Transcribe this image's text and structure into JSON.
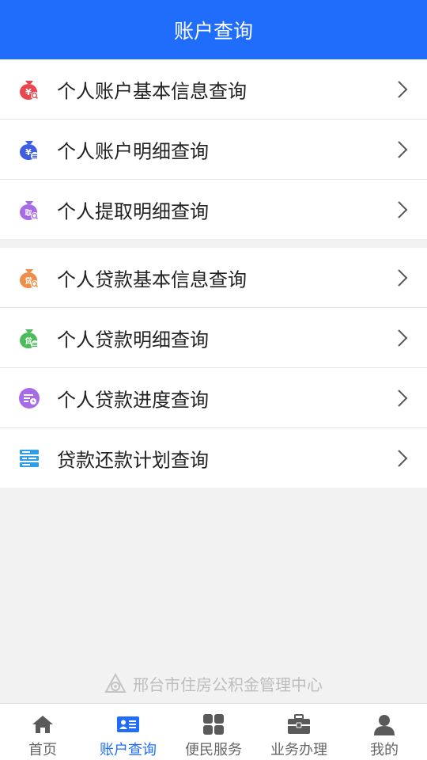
{
  "header": {
    "title": "账户查询"
  },
  "colors": {
    "primary": "#1f6dfa",
    "tab_inactive": "#666666",
    "icon_red": "#e8474e",
    "icon_blue": "#3d5fe0",
    "icon_purple": "#a86be6",
    "icon_orange": "#ee8e4b",
    "icon_green": "#4bbb5b",
    "icon_teal": "#2d9ee8"
  },
  "section1": {
    "items": [
      {
        "label": "个人账户基本信息查询",
        "icon": "money-bag-search-icon"
      },
      {
        "label": "个人账户明细查询",
        "icon": "money-bag-list-icon"
      },
      {
        "label": "个人提取明细查询",
        "icon": "withdraw-bag-search-icon"
      }
    ]
  },
  "section2": {
    "items": [
      {
        "label": "个人贷款基本信息查询",
        "icon": "loan-bag-search-icon"
      },
      {
        "label": "个人贷款明细查询",
        "icon": "loan-bag-list-icon"
      },
      {
        "label": "个人贷款进度查询",
        "icon": "loan-progress-icon"
      },
      {
        "label": "贷款还款计划查询",
        "icon": "repayment-plan-icon"
      }
    ]
  },
  "footer": {
    "brand_text": "邢台市住房公积金管理中心"
  },
  "tabbar": {
    "items": [
      {
        "label": "首页",
        "icon": "home-icon",
        "active": false
      },
      {
        "label": "账户查询",
        "icon": "id-card-icon",
        "active": true
      },
      {
        "label": "便民服务",
        "icon": "grid-icon",
        "active": false
      },
      {
        "label": "业务办理",
        "icon": "briefcase-icon",
        "active": false
      },
      {
        "label": "我的",
        "icon": "user-icon",
        "active": false
      }
    ]
  }
}
